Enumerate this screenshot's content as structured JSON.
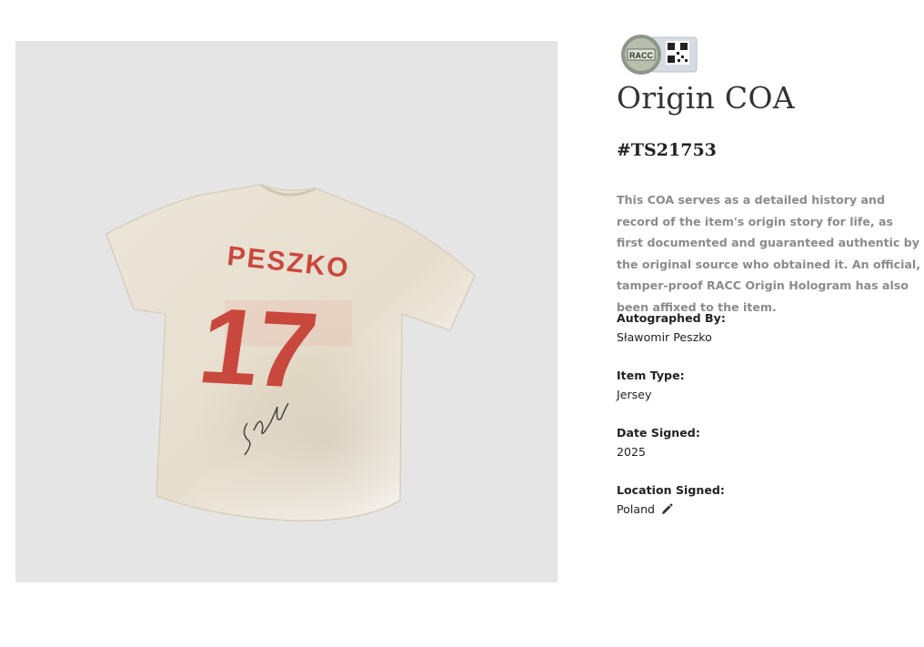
{
  "header": {
    "badge_text": "RACC",
    "title": "Origin COA",
    "coa_id": "#TS21753"
  },
  "description": "This COA serves as a detailed history and record of the item's origin story for life, as first documented and guaranteed authentic by the original source who obtained it. An official, tamper-proof RACC Origin Hologram has also been affixed to the item.",
  "fields": [
    {
      "label": "Autographed By:",
      "value": "Sławomir Peszko"
    },
    {
      "label": "Item Type:",
      "value": "Jersey"
    },
    {
      "label": "Date Signed:",
      "value": "2025"
    },
    {
      "label": "Location Signed:",
      "value": "Poland",
      "icon": "pencil-icon"
    }
  ],
  "product_image": {
    "jersey_name": "PESZKO",
    "jersey_number": "17",
    "background_color": "#e5e5e5",
    "print_color": "#c9483e"
  }
}
